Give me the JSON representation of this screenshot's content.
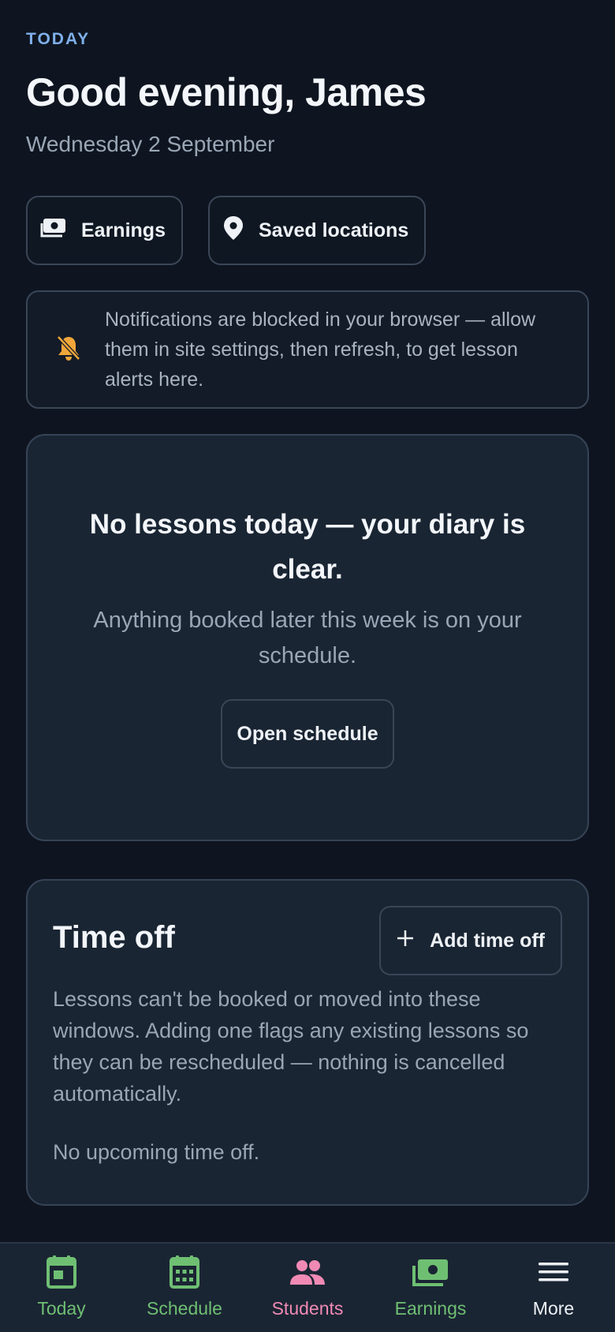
{
  "header": {
    "eyebrow": "TODAY",
    "greeting": "Good evening, James",
    "date": "Wednesday 2 September"
  },
  "quick_links": [
    {
      "label": "Earnings",
      "icon": "money-icon"
    },
    {
      "label": "Saved locations",
      "icon": "location-pin-icon"
    }
  ],
  "notice": {
    "icon": "bell-off-icon",
    "text": "Notifications are blocked in your browser — allow them in site settings, then refresh, to get lesson alerts here."
  },
  "empty_state": {
    "title": "No lessons today — your diary is clear.",
    "subtitle": "Anything booked later this week is on your schedule.",
    "button": "Open schedule"
  },
  "time_off": {
    "title": "Time off",
    "add_button": "Add time off",
    "description": "Lessons can't be booked or moved into these windows. Adding one flags any existing lessons so they can be rescheduled — nothing is cancelled automatically.",
    "empty": "No upcoming time off."
  },
  "tabs": [
    {
      "label": "Today",
      "icon": "today-icon",
      "color": "#6fbf73"
    },
    {
      "label": "Schedule",
      "icon": "calendar-icon",
      "color": "#6fbf73"
    },
    {
      "label": "Students",
      "icon": "students-icon",
      "color": "#f08ab4"
    },
    {
      "label": "Earnings",
      "icon": "money-icon",
      "color": "#6fbf73"
    },
    {
      "label": "More",
      "icon": "menu-icon",
      "color": "#eef2f7"
    }
  ],
  "colors": {
    "accent_blue": "#7fb0ea",
    "warning_amber": "#f0a63a",
    "green": "#6fbf73",
    "pink": "#f08ab4"
  }
}
